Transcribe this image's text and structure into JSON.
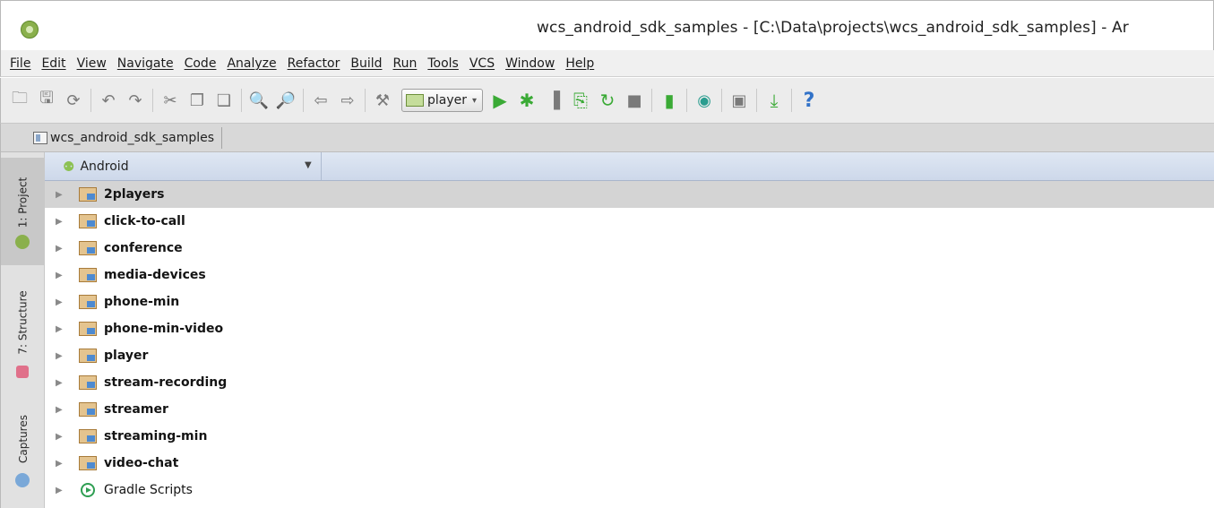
{
  "window": {
    "title": "wcs_android_sdk_samples - [C:\\Data\\projects\\wcs_android_sdk_samples] - Ar"
  },
  "menu": [
    {
      "label": "File"
    },
    {
      "label": "Edit"
    },
    {
      "label": "View"
    },
    {
      "label": "Navigate"
    },
    {
      "label": "Code"
    },
    {
      "label": "Analyze"
    },
    {
      "label": "Refactor"
    },
    {
      "label": "Build"
    },
    {
      "label": "Run"
    },
    {
      "label": "Tools"
    },
    {
      "label": "VCS"
    },
    {
      "label": "Window"
    },
    {
      "label": "Help"
    }
  ],
  "toolbar": {
    "run_config_label": "player",
    "help_glyph": "?"
  },
  "breadcrumb": {
    "label": "wcs_android_sdk_samples"
  },
  "left_strip": {
    "tabs": [
      {
        "label": "1: Project",
        "active": true
      },
      {
        "label": "7: Structure",
        "active": false
      },
      {
        "label": "Captures",
        "active": false
      }
    ]
  },
  "project_panel": {
    "view_mode": "Android",
    "items": [
      {
        "label": "2players",
        "kind": "module",
        "selected": true
      },
      {
        "label": "click-to-call",
        "kind": "module"
      },
      {
        "label": "conference",
        "kind": "module"
      },
      {
        "label": "media-devices",
        "kind": "module"
      },
      {
        "label": "phone-min",
        "kind": "module"
      },
      {
        "label": "phone-min-video",
        "kind": "module"
      },
      {
        "label": "player",
        "kind": "module"
      },
      {
        "label": "stream-recording",
        "kind": "module"
      },
      {
        "label": "streamer",
        "kind": "module"
      },
      {
        "label": "streaming-min",
        "kind": "module"
      },
      {
        "label": "video-chat",
        "kind": "module"
      },
      {
        "label": "Gradle Scripts",
        "kind": "gradle"
      }
    ]
  }
}
